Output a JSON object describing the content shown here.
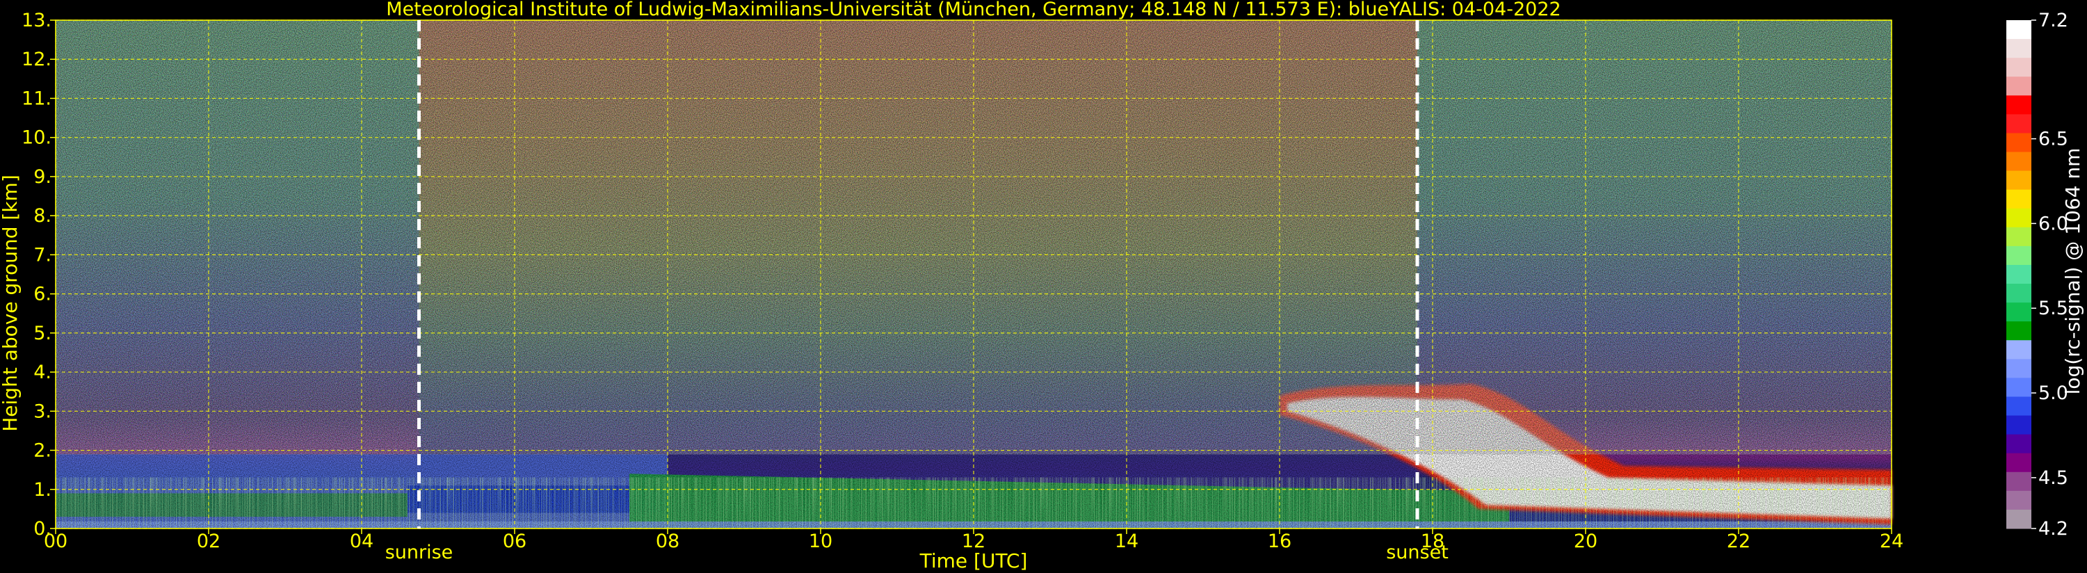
{
  "chart_data": {
    "type": "heatmap",
    "title": "Meteorological Institute of Ludwig-Maximilians-Universität (München, Germany; 48.148 N / 11.573 E):     blueYALIS: 04-04-2022",
    "xlabel": "Time [UTC]",
    "ylabel": "Height above ground [km]",
    "xlim": [
      0,
      24
    ],
    "ylim": [
      0,
      13
    ],
    "x_ticks": [
      0,
      2,
      4,
      6,
      8,
      10,
      12,
      14,
      16,
      18,
      20,
      22,
      24
    ],
    "x_tick_labels": [
      "00",
      "02",
      "04",
      "06",
      "08",
      "10",
      "12",
      "14",
      "16",
      "18",
      "20",
      "22",
      "24"
    ],
    "y_ticks": [
      0,
      1,
      2,
      3,
      4,
      5,
      6,
      7,
      8,
      9,
      10,
      11,
      12,
      13
    ],
    "y_tick_labels": [
      "0.",
      "1.",
      "2.",
      "3.",
      "4.",
      "5.",
      "6.",
      "7.",
      "8.",
      "9.",
      "10.",
      "11.",
      "12.",
      "13."
    ],
    "grid": true,
    "events": [
      {
        "label": "sunrise",
        "x": 4.75
      },
      {
        "label": "sunset",
        "x": 17.8
      }
    ],
    "colorbar": {
      "label": "log(rc-signal) @ 1064 nm",
      "range": [
        4.2,
        7.2
      ],
      "tick_values": [
        4.2,
        4.5,
        5.0,
        5.5,
        6.0,
        6.5,
        7.2
      ],
      "tick_labels": [
        "4.2",
        "4.5",
        "5.0",
        "5.5",
        "6.0",
        "6.5",
        "7.2"
      ],
      "colors": [
        "#a898a8",
        "#a070a0",
        "#904890",
        "#800080",
        "#5000a0",
        "#2020d0",
        "#3050f0",
        "#6080ff",
        "#8098ff",
        "#9cb0ff",
        "#00a000",
        "#10c050",
        "#30d080",
        "#50e0a0",
        "#80f080",
        "#b0f040",
        "#e0f000",
        "#ffe000",
        "#ffb000",
        "#ff8000",
        "#ff5000",
        "#ff2020",
        "#ff0000",
        "#f0a0a0",
        "#f0c8c8",
        "#f0e0e0",
        "#ffffff"
      ]
    },
    "colors": {
      "axis_text": "#ffff00",
      "grid": "#ffff00",
      "event_line": "#ffffff",
      "colorbar_text": "#ffffff"
    }
  }
}
